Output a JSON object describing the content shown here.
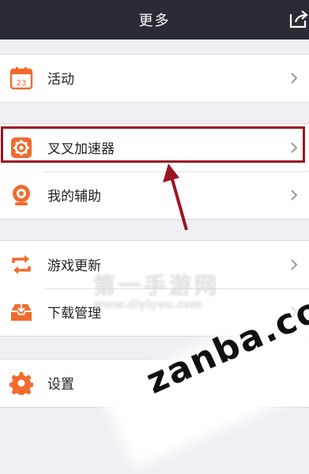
{
  "header": {
    "title": "更多",
    "share_icon": "share-icon"
  },
  "groups": [
    {
      "items": [
        {
          "label": "活动",
          "icon": "calendar-icon",
          "icon_text": "23"
        }
      ]
    },
    {
      "items": [
        {
          "label": "叉叉加速器",
          "icon": "gear-icon"
        },
        {
          "label": "我的辅助",
          "icon": "webcam-icon"
        }
      ]
    },
    {
      "items": [
        {
          "label": "游戏更新",
          "icon": "refresh-icon"
        },
        {
          "label": "下载管理",
          "icon": "download-tray-icon"
        }
      ]
    },
    {
      "items": [
        {
          "label": "设置",
          "icon": "settings-gear-icon"
        }
      ]
    }
  ],
  "colors": {
    "header_bg": "#2b2b33",
    "accent": "#f26b2c",
    "highlight": "#9b1521",
    "page_bg": "#efeff4"
  },
  "watermark": {
    "site_name": "第一手游网",
    "site_url": "www.diyiyou.com",
    "brand": "zanba.com"
  }
}
